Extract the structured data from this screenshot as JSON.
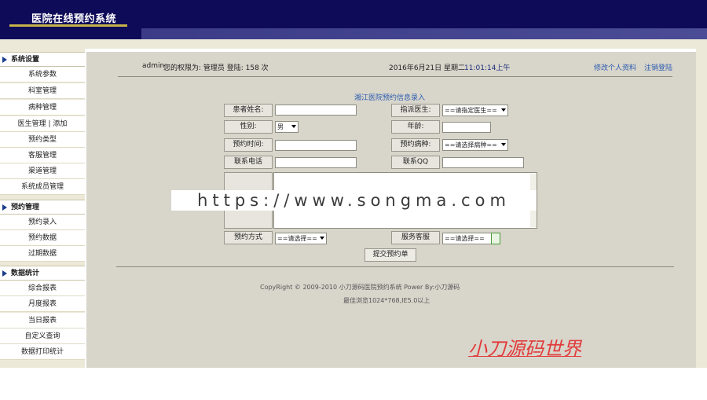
{
  "header": {
    "title": "医院在线预约系统"
  },
  "sidebar": {
    "groups": [
      {
        "title": "系统设置",
        "items": [
          "系统参数",
          "科室管理",
          "病种管理",
          "医生管理 | 添加",
          "预约类型",
          "客服管理",
          "渠道管理",
          "系统成员管理"
        ]
      },
      {
        "title": "预约管理",
        "items": [
          "预约录入",
          "预约数据",
          "过期数据"
        ]
      },
      {
        "title": "数据统计",
        "items": [
          "综合报表",
          "月度报表",
          "当日报表",
          "自定义查询",
          "数据打印统计"
        ]
      }
    ]
  },
  "topbar": {
    "user": "admin",
    "role_text": "您的权限为: 管理员 登陆: 158 次",
    "datetime": "2016年6月21日 星期二",
    "time": "11:01:14上午",
    "profile_link": "修改个人资料",
    "logout_link": "注销登陆"
  },
  "form": {
    "title": "湘江医院预约信息录入",
    "patient_name_label": "患者姓名:",
    "doctor_label": "指派医生:",
    "doctor_select": "==请指定医生==",
    "gender_label": "性别:",
    "gender_select": "男",
    "age_label": "年龄:",
    "time_label": "预约时间:",
    "disease_label": "预约病种:",
    "disease_select": "==请选择病种==",
    "phone_label": "联系电话",
    "qq_label": "联系QQ",
    "method_label": "预约方式",
    "method_select": "==请选择==",
    "service_label": "服务客服",
    "service_select": "==请选择==",
    "submit_label": "提交预约单"
  },
  "footer": {
    "copyright": "CopyRight © 2009-2010 小刀源码医院预约系统 Power By:小刀源码",
    "browser_note": "最佳浏览1024*768,IE5.0以上"
  },
  "watermark": {
    "text": "https://www.songma.com"
  },
  "brand": {
    "text": "小刀源码世界"
  }
}
